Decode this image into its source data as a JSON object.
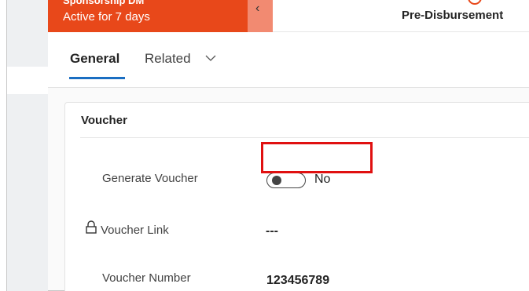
{
  "header": {
    "stage_title": "Sponsorship DM",
    "stage_subtitle": "Active for 7 days",
    "stage_name": "Pre-Disbursement",
    "back_icon": "chevron-left-icon"
  },
  "tabs": [
    {
      "label": "General",
      "selected": true
    },
    {
      "label": "Related",
      "selected": false
    }
  ],
  "section": {
    "title": "Voucher",
    "fields": {
      "generate_voucher": {
        "label": "Generate Voucher",
        "value": "No",
        "type": "toggle",
        "checked": false
      },
      "voucher_link": {
        "label": "Voucher Link",
        "value": "---",
        "locked": true
      },
      "voucher_number": {
        "label": "Voucher Number",
        "value": "123456789"
      }
    }
  },
  "colors": {
    "stage_active": "#e8481a",
    "tab_underline": "#1b6ec2",
    "highlight": "#e01010"
  }
}
